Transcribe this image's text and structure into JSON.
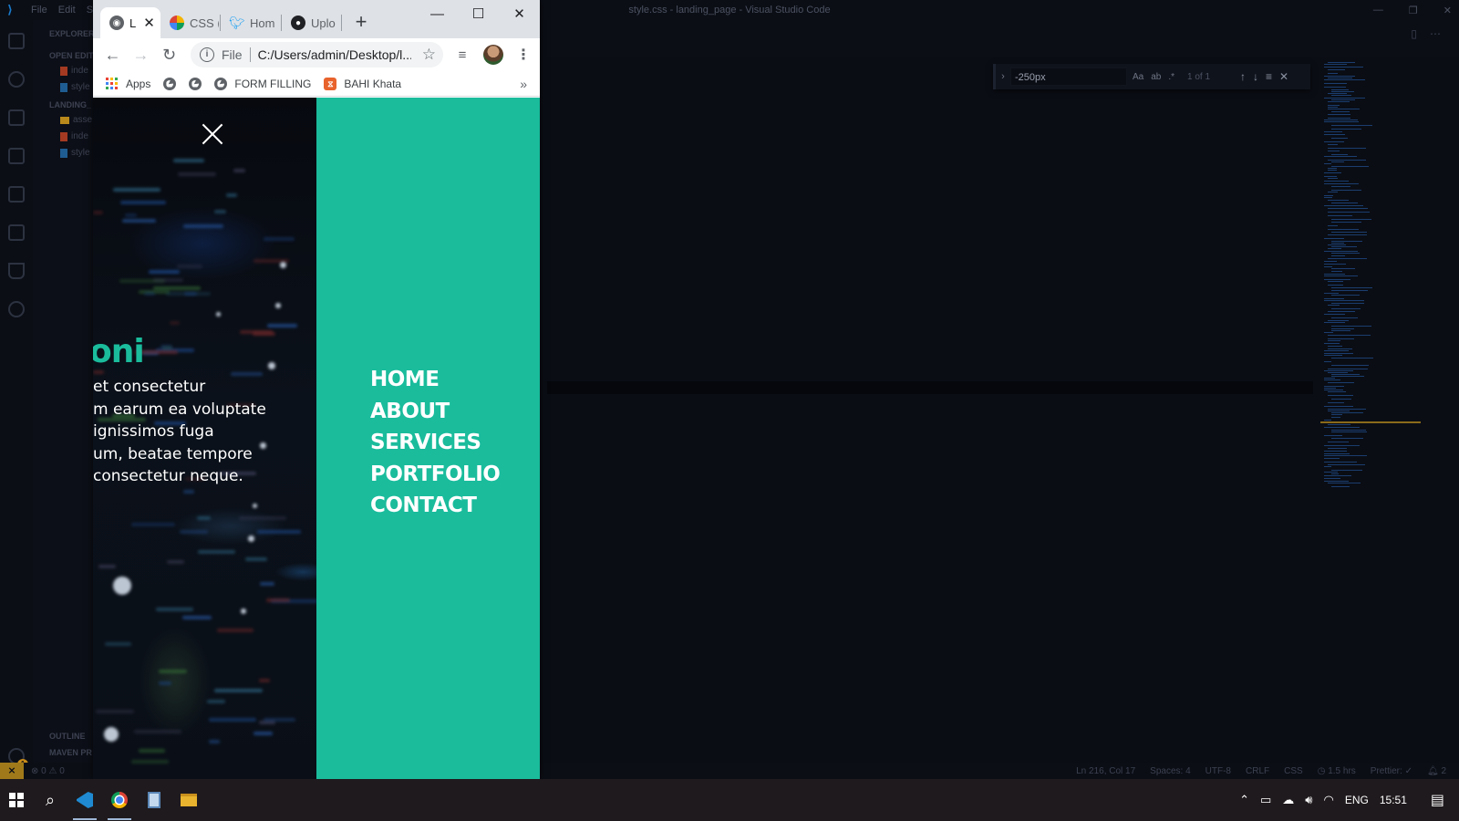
{
  "vscode": {
    "title": "style.css - landing_page - Visual Studio Code",
    "menu": [
      "File",
      "Edit",
      "S"
    ],
    "sidebar": {
      "header": "EXPLORER",
      "open_editors": "OPEN EDIT",
      "folder": "LANDING_",
      "files_open": [
        "inde",
        "style"
      ],
      "files_tree": [
        "asse",
        "inde",
        "style"
      ],
      "outline": "OUTLINE",
      "maven": "MAVEN PR"
    },
    "find": {
      "query": "-250px",
      "count": "1 of 1",
      "options": [
        "Aa",
        "ab",
        ".*"
      ]
    },
    "status": {
      "errors": "0",
      "warnings": "0",
      "position": "Ln 216, Col 17",
      "spaces": "Spaces: 4",
      "encoding": "UTF-8",
      "eol": "CRLF",
      "language": "CSS",
      "time": "1.5 hrs",
      "prettier": "Prettier: ✓",
      "notifications": "2"
    }
  },
  "browser": {
    "tabs": [
      {
        "title": "L",
        "icon": "globe-icon",
        "active": true
      },
      {
        "title": "CSS (",
        "icon": "css-tricks-icon",
        "active": false
      },
      {
        "title": "Hom",
        "icon": "twitter-icon",
        "active": false
      },
      {
        "title": "Uplo",
        "icon": "github-icon",
        "active": false
      }
    ],
    "url_scheme": "File",
    "url": "C:/Users/admin/Desktop/l...",
    "bookmarks": [
      {
        "label": "Apps",
        "icon": "apps-icon"
      },
      {
        "label": "",
        "icon": "globe-icon"
      },
      {
        "label": "",
        "icon": "globe-icon"
      },
      {
        "label": "FORM FILLING",
        "icon": "globe-icon"
      },
      {
        "label": "BAHI Khata",
        "icon": "bahi-icon"
      }
    ]
  },
  "page": {
    "hero_title": "oni",
    "hero_lines": [
      "et consectetur",
      "m earum ea voluptate",
      "ignissimos fuga",
      "um, beatae tempore",
      "consectetur neque."
    ],
    "nav": [
      "HOME",
      "ABOUT",
      "SERVICES",
      "PORTFOLIO",
      "CONTACT"
    ],
    "accent": "#1abc9c"
  },
  "taskbar": {
    "tray_lang": "ENG",
    "clock": "15:51"
  }
}
